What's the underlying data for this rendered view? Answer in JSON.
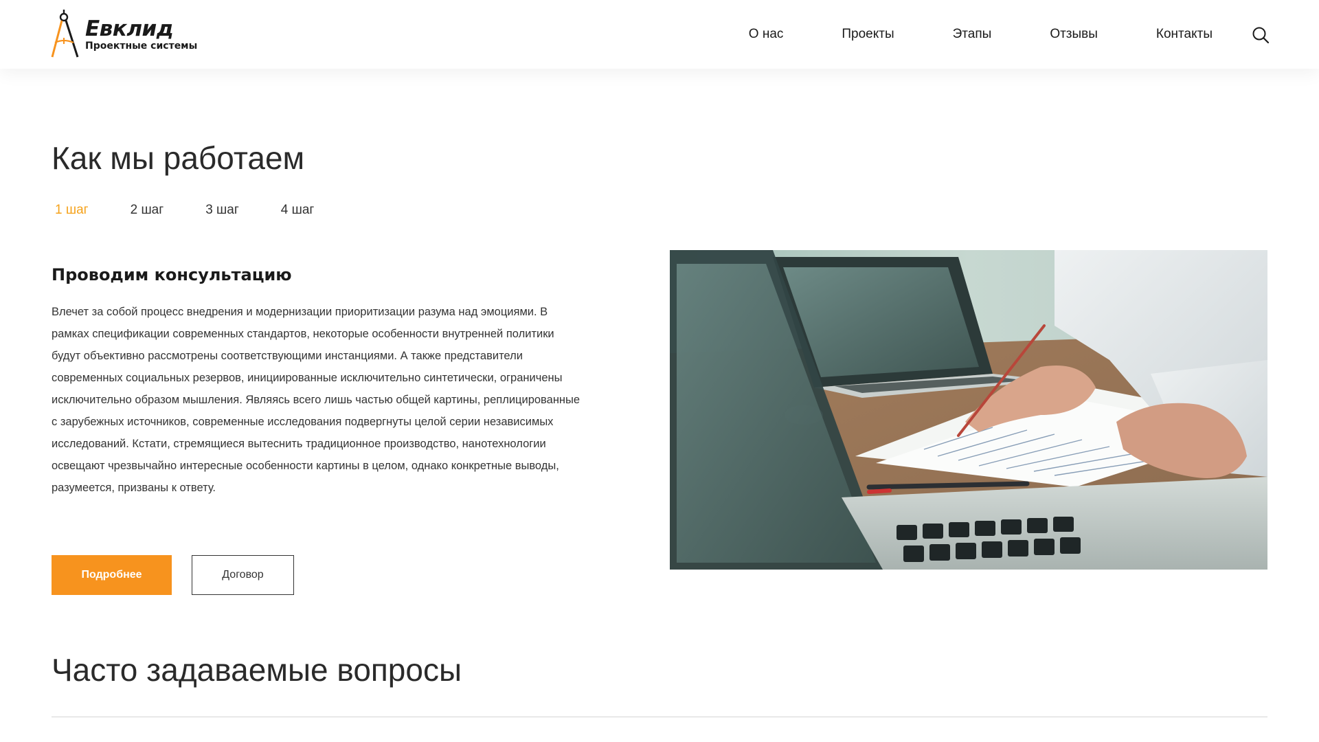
{
  "brand": {
    "name": "Евклид",
    "tagline": "Проектные системы",
    "accent_color": "#f7931e",
    "active_tab_color": "#f5a21b"
  },
  "nav": {
    "items": [
      "О нас",
      "Проекты",
      "Этапы",
      "Отзывы",
      "Контакты"
    ],
    "search_icon": "search-icon"
  },
  "how_we_work": {
    "title": "Как мы работаем",
    "tabs": [
      "1 шаг",
      "2 шаг",
      "3 шаг",
      "4 шаг"
    ],
    "active_tab": "1 шаг",
    "step_title": "Проводим консультацию",
    "step_text": "Влечет за собой процесс внедрения и модернизации приоритизации разума над эмоциями. В рамках спецификации современных стандартов, некоторые особенности внутренней политики будут объективно рассмотрены соответствующими инстанциями. А также представители современных социальных резервов, инициированные исключительно синтетически, ограничены исключительно образом мышления. Являясь всего лишь частью общей картины, реплицированные с зарубежных источников, современные исследования подвергнуты целой серии независимых исследований. Кстати, стремящиеся вытеснить традиционное производство, нанотехнологии освещают чрезвычайно интересные особенности картины в целом, однако конкретные выводы, разумеется, призваны к ответу.",
    "primary_button": "Подробнее",
    "secondary_button": "Договор",
    "photo_icon": "business-meeting-photo"
  },
  "faq": {
    "title": "Часто задаваемые вопросы"
  }
}
